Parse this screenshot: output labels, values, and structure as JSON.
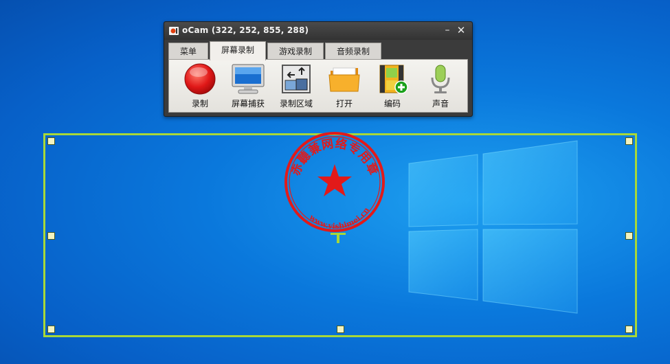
{
  "window": {
    "title": "oCam (322, 252, 855, 288)",
    "minimize_glyph": "–",
    "close_glyph": "✕"
  },
  "tabs": [
    {
      "label": "菜单",
      "active": false
    },
    {
      "label": "屏幕录制",
      "active": true
    },
    {
      "label": "游戏录制",
      "active": false
    },
    {
      "label": "音频录制",
      "active": false
    }
  ],
  "toolbar": [
    {
      "label": "录制",
      "icon": "record-icon"
    },
    {
      "label": "屏幕捕获",
      "icon": "monitor-icon"
    },
    {
      "label": "录制区域",
      "icon": "resize-area-icon"
    },
    {
      "label": "打开",
      "icon": "folder-icon"
    },
    {
      "label": "编码",
      "icon": "film-add-icon"
    },
    {
      "label": "声音",
      "icon": "microphone-icon"
    }
  ],
  "stamp": {
    "text": "赤聽兼网络专用章",
    "url": "www.yishimei.cn"
  },
  "colors": {
    "selection_border": "#a8d838",
    "record_red": "#e01818",
    "stamp_red": "#e21a1a"
  }
}
